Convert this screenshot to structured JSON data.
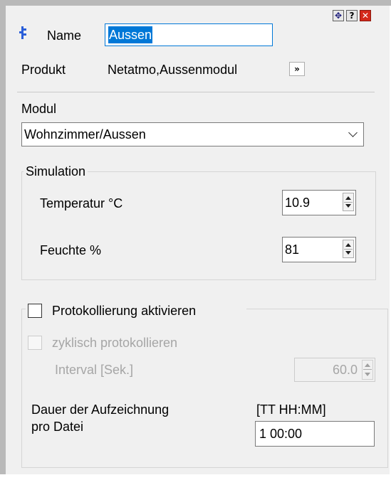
{
  "header": {
    "name_label": "Name",
    "name_value": "Aussen",
    "product_label": "Produkt",
    "product_value": "Netatmo,Aussenmodul",
    "expand_button": "»",
    "icons": {
      "device": "device-icon",
      "move": "move-icon",
      "help": "help-icon",
      "close": "close-icon"
    },
    "help_glyph": "?",
    "close_glyph": "✕",
    "move_glyph": "✥"
  },
  "modul": {
    "label": "Modul",
    "selected": "Wohnzimmer/Aussen"
  },
  "simulation": {
    "title": "Simulation",
    "temperature_label": "Temperatur °C",
    "temperature_value": "10.9",
    "humidity_label": "Feuchte %",
    "humidity_value": "81"
  },
  "logging": {
    "enable_label": "Protokollierung aktivieren",
    "enable_checked": false,
    "cyclic_label": "zyklisch protokollieren",
    "cyclic_checked": false,
    "interval_label": "Interval [Sek.]",
    "interval_value": "60.0",
    "duration_label_line1": "Dauer der Aufzeichnung",
    "duration_label_line2": "pro Datei",
    "duration_format": "[TT HH:MM]",
    "duration_value": "1 00:00"
  },
  "colors": {
    "accent": "#0078d7",
    "close_red": "#d4281a",
    "panel_bg": "#f0f0f0",
    "disabled_text": "#a6a6a6"
  }
}
